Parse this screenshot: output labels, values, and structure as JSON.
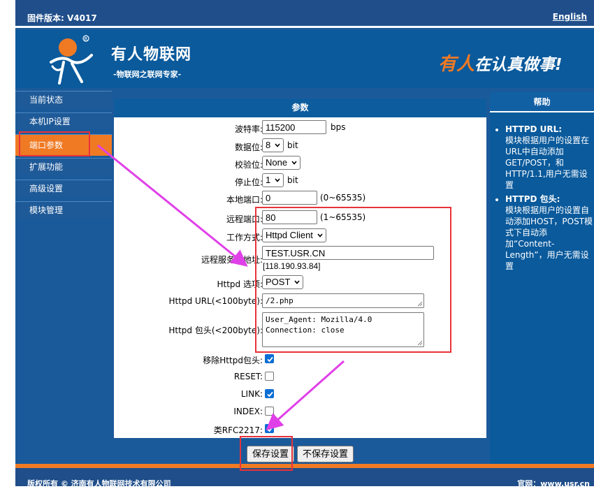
{
  "topbar": {
    "firmware": "固件版本: V4017",
    "language_link": "English"
  },
  "banner": {
    "brand_name": "有人物联网",
    "brand_sub": "-物联网之联网专家-",
    "slogan_part1": "有人",
    "slogan_part2": "在认真做事!"
  },
  "sidebar": {
    "items": [
      {
        "label": "当前状态"
      },
      {
        "label": "本机IP设置"
      },
      {
        "label": "端口参数",
        "active": true
      },
      {
        "label": "扩展功能"
      },
      {
        "label": "高级设置"
      },
      {
        "label": "模块管理"
      }
    ]
  },
  "params": {
    "title": "参数",
    "baud": {
      "label": "波特率:",
      "value": "115200",
      "unit": "bps"
    },
    "data_bits": {
      "label": "数据位:",
      "value": "8",
      "unit": "bit"
    },
    "parity": {
      "label": "校验位:",
      "value": "None"
    },
    "stop_bits": {
      "label": "停止位:",
      "value": "1",
      "unit": "bit"
    },
    "local_port": {
      "label": "本地端口:",
      "value": "0",
      "range": "(0~65535)"
    },
    "remote_port": {
      "label": "远程端口:",
      "value": "80",
      "range": "(1~65535)"
    },
    "work_mode": {
      "label": "工作方式:",
      "value": "Httpd Client"
    },
    "remote_server": {
      "label": "远程服务器地址:",
      "value": "TEST.USR.CN",
      "resolved": "[118.190.93.84]"
    },
    "httpd_option": {
      "label": "Httpd 选项:",
      "value": "POST"
    },
    "httpd_url": {
      "label": "Httpd URL(<100byte):",
      "value": "/2.php"
    },
    "httpd_header": {
      "label": "Httpd 包头(<200byte):",
      "value": "User_Agent: Mozilla/4.0\nConnection: close"
    },
    "remove_header": {
      "label": "移除Httpd包头:",
      "checked": true
    },
    "reset": {
      "label": "RESET:",
      "checked": false
    },
    "link": {
      "label": "LINK:",
      "checked": true
    },
    "index": {
      "label": "INDEX:",
      "checked": false
    },
    "rfc2217": {
      "label": "类RFC2217:",
      "checked": true
    }
  },
  "buttons": {
    "save": "保存设置",
    "nosave": "不保存设置"
  },
  "help": {
    "title": "帮助",
    "items": [
      {
        "title": "HTTPD URL:",
        "text": "模块根据用户的设置在URL中自动添加GET/POST，和HTTP/1.1,用户无需设置"
      },
      {
        "title": "HTTPD 包头:",
        "text": "模块根据用户的设置自动添加HOST，POST模式下自动添加“Content-Length”，用户无需设置"
      }
    ]
  },
  "footer": {
    "copyright": "版权所有 © 济南有人物联网技术有限公司",
    "site": "官网：www.usr.cn"
  },
  "colors": {
    "accent": "#f07a24",
    "nav_blue": "#1f5a98",
    "annotation_red": "#e8323a",
    "annotation_arrow": "#e040e8"
  }
}
